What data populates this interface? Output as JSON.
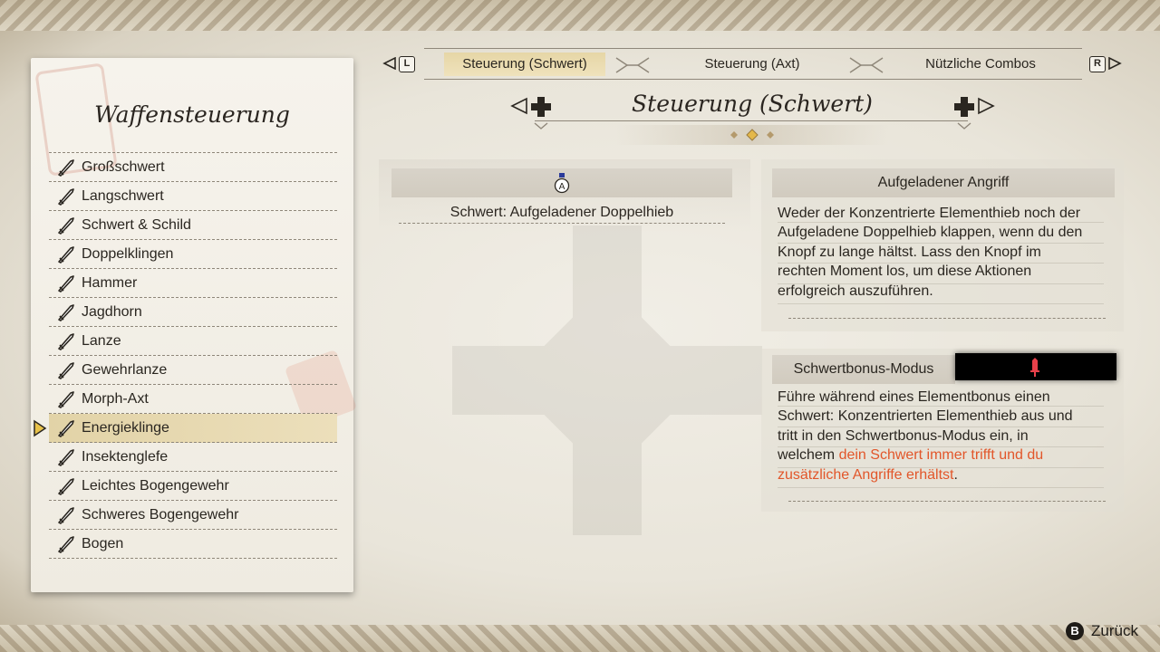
{
  "sidebar": {
    "title": "Waffensteuerung",
    "items": [
      {
        "label": "Großschwert",
        "icon": "great-sword-icon"
      },
      {
        "label": "Langschwert",
        "icon": "long-sword-icon"
      },
      {
        "label": "Schwert & Schild",
        "icon": "sword-and-shield-icon"
      },
      {
        "label": "Doppelklingen",
        "icon": "dual-blades-icon"
      },
      {
        "label": "Hammer",
        "icon": "hammer-icon"
      },
      {
        "label": "Jagdhorn",
        "icon": "hunting-horn-icon"
      },
      {
        "label": "Lanze",
        "icon": "lance-icon"
      },
      {
        "label": "Gewehrlanze",
        "icon": "gunlance-icon"
      },
      {
        "label": "Morph-Axt",
        "icon": "switch-axe-icon"
      },
      {
        "label": "Energieklinge",
        "icon": "charge-blade-icon",
        "selected": true
      },
      {
        "label": "Insektenglefe",
        "icon": "insect-glaive-icon"
      },
      {
        "label": "Leichtes Bogengewehr",
        "icon": "light-bowgun-icon"
      },
      {
        "label": "Schweres Bogengewehr",
        "icon": "heavy-bowgun-icon"
      },
      {
        "label": "Bogen",
        "icon": "bow-icon"
      }
    ]
  },
  "tabs": {
    "left_key": "L",
    "right_key": "R",
    "items": [
      {
        "label": "Steuerung (Schwert)",
        "active": true
      },
      {
        "label": "Steuerung (Axt)",
        "active": false
      },
      {
        "label": "Nützliche Combos",
        "active": false
      }
    ]
  },
  "page": {
    "title": "Steuerung (Schwert)",
    "pager_dots": 3,
    "pager_active_index": 1
  },
  "control": {
    "button_icon": "a-button-icon",
    "button_glyph": "A",
    "action": "Schwert: Aufgeladener Doppelhieb"
  },
  "info": {
    "heading": "Aufgeladener Angriff",
    "body": "Weder der Konzentrierte Elementhieb noch der Aufgeladene Doppelhieb klappen, wenn du den Knopf zu lange hältst. Lass den Knopf im rechten Moment los, um diese Aktionen erfolgreich auszuführen."
  },
  "bonus": {
    "heading": "Schwertbonus-Modus",
    "icon": "red-sword-icon",
    "body_plain": "Führe während eines Elementbonus einen Schwert: Konzentrierten Elementhieb aus und tritt in den Schwertbonus-Modus ein, in welchem ",
    "body_highlight": "dein Schwert immer trifft und du zusätzliche Angriffe erhältst",
    "body_end": ".",
    "highlight_color": "#e2562a"
  },
  "footer": {
    "back_key": "B",
    "back_label": "Zurück"
  }
}
